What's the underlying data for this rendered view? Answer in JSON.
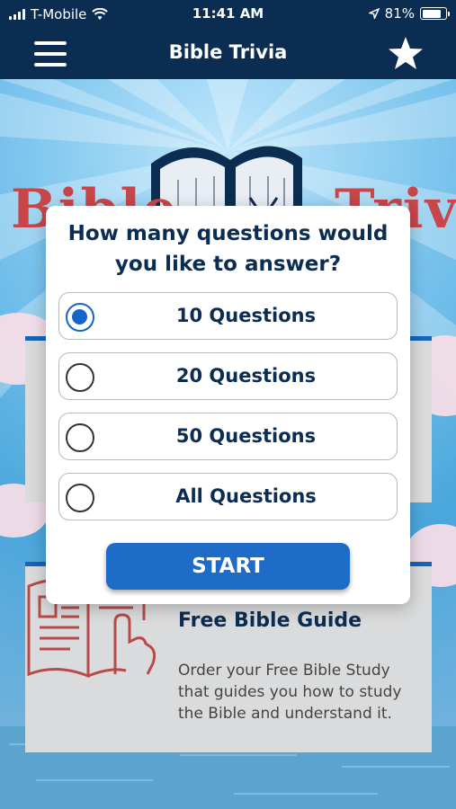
{
  "status_bar": {
    "carrier": "T-Mobile",
    "time": "11:41 AM",
    "battery_percent": "81%",
    "battery_level": 0.81
  },
  "nav": {
    "title": "Bible Trivia",
    "menu_icon": "hamburger-menu-icon",
    "favorite_icon": "star-icon"
  },
  "background": {
    "logo_left": "Bible",
    "logo_right": "Trivia"
  },
  "modal": {
    "question": "How many questions would you like to answer?",
    "options": [
      {
        "label": "10 Questions",
        "selected": true
      },
      {
        "label": "20 Questions",
        "selected": false
      },
      {
        "label": "50 Questions",
        "selected": false
      },
      {
        "label": "All Questions",
        "selected": false
      }
    ],
    "start_label": "START"
  },
  "guide_card": {
    "title": "Free Bible Guide",
    "description": "Order your Free Bible Study that guides you how to study the Bible and understand it."
  },
  "colors": {
    "nav_bg": "#0c2d52",
    "accent": "#1f6cc8",
    "logo_red": "#c8464a"
  }
}
